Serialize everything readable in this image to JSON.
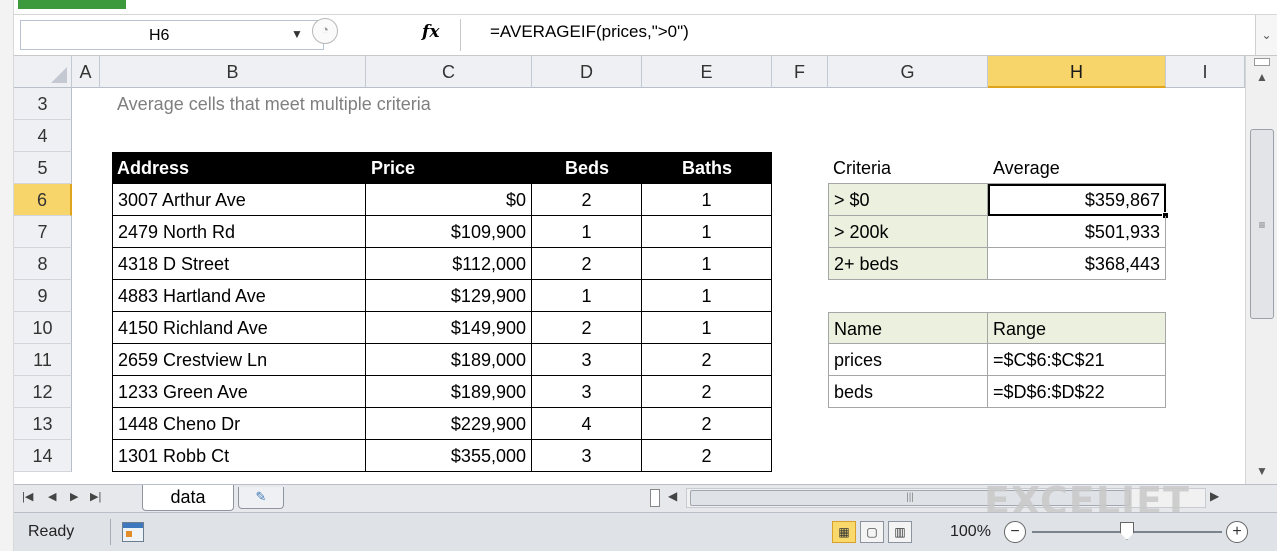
{
  "formula_bar": {
    "name_box": "H6",
    "fx_label": "fx",
    "formula": "=AVERAGEIF(prices,\">0\")"
  },
  "columns": [
    "A",
    "B",
    "C",
    "D",
    "E",
    "F",
    "G",
    "H",
    "I"
  ],
  "rows": [
    "3",
    "4",
    "5",
    "6",
    "7",
    "8",
    "9",
    "10",
    "11",
    "12",
    "13",
    "14"
  ],
  "sheet_title": "Average cells that meet multiple criteria",
  "table": {
    "headers": [
      "Address",
      "Price",
      "Beds",
      "Baths"
    ],
    "rows": [
      [
        "3007 Arthur Ave",
        "$0",
        "2",
        "1"
      ],
      [
        "2479 North Rd",
        "$109,900",
        "1",
        "1"
      ],
      [
        "4318 D Street",
        "$112,000",
        "2",
        "1"
      ],
      [
        "4883 Hartland Ave",
        "$129,900",
        "1",
        "1"
      ],
      [
        "4150 Richland Ave",
        "$149,900",
        "2",
        "1"
      ],
      [
        "2659 Crestview Ln",
        "$189,000",
        "3",
        "2"
      ],
      [
        "1233 Green Ave",
        "$189,900",
        "3",
        "2"
      ],
      [
        "1448 Cheno Dr",
        "$229,900",
        "4",
        "2"
      ],
      [
        "1301 Robb Ct",
        "$355,000",
        "3",
        "2"
      ]
    ]
  },
  "criteria_table": {
    "headers": [
      "Criteria",
      "Average"
    ],
    "rows": [
      [
        "> $0",
        "$359,867"
      ],
      [
        "> 200k",
        "$501,933"
      ],
      [
        "2+ beds",
        "$368,443"
      ]
    ]
  },
  "names_table": {
    "headers": [
      "Name",
      "Range"
    ],
    "rows": [
      [
        "prices",
        "=$C$6:$C$21"
      ],
      [
        "beds",
        "=$D$6:$D$22"
      ]
    ]
  },
  "sheet_tabs": [
    "data"
  ],
  "watermark": "EXCELJET",
  "status": {
    "ready": "Ready",
    "zoom": "100%"
  },
  "colors": {
    "accent_selected": "#f7d56a",
    "criteria_fill": "#ebf1de",
    "header_fill": "#000000"
  }
}
